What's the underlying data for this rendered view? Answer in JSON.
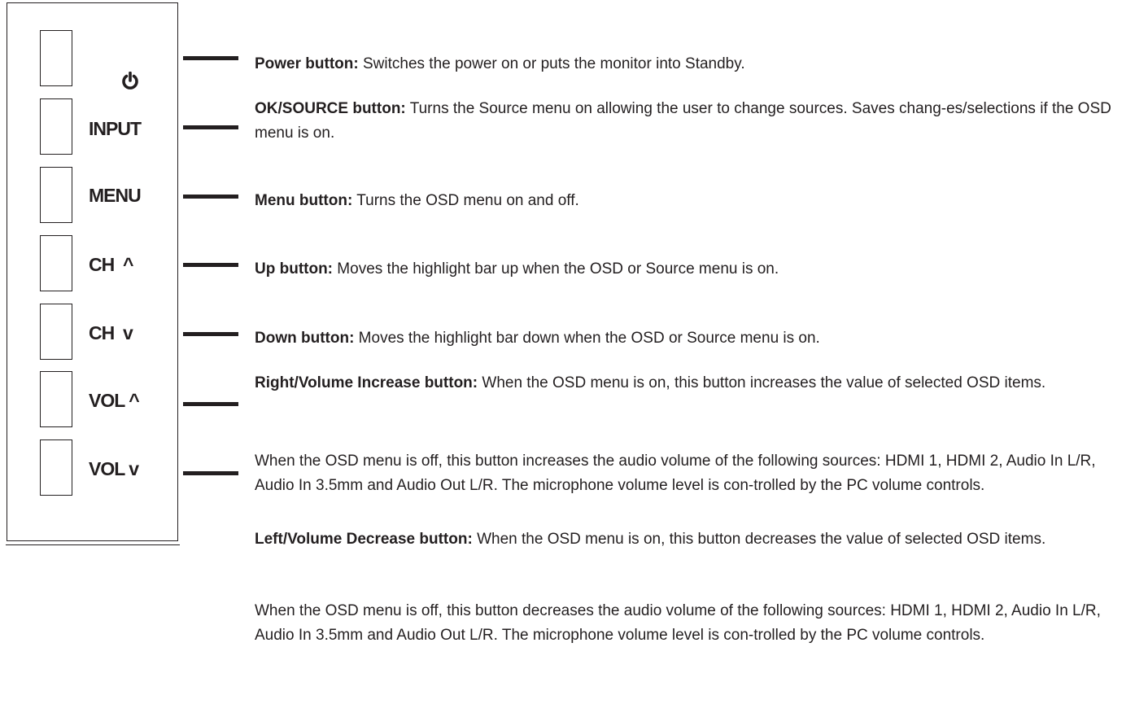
{
  "keys": [
    {
      "label": "",
      "icon": "power-icon"
    },
    {
      "label": "INPUT"
    },
    {
      "label": "MENU"
    },
    {
      "label": "CH  ^"
    },
    {
      "label": "CH  v"
    },
    {
      "label": "VOL ^"
    },
    {
      "label": "VOL v"
    }
  ],
  "descriptions": [
    {
      "title": "Power button:",
      "text": " Switches the power on or puts the monitor into Standby."
    },
    {
      "title": "OK/SOURCE button:",
      "text": " Turns the Source menu on allowing the user to change sources. Saves chang-es/selections if the OSD menu is on."
    },
    {
      "title": "Menu button:",
      "text": " Turns the OSD menu on and off."
    },
    {
      "title": "Up button:",
      "text": " Moves the highlight bar up when the OSD or Source menu is on."
    },
    {
      "title": "Down button:",
      "text": " Moves the highlight bar down when the OSD or Source menu is on."
    },
    {
      "title": "Right/Volume Increase button:",
      "text": " When the OSD menu is on, this button increases the value of selected OSD items."
    },
    {
      "title": "",
      "text": "When the OSD menu is off, this button increases the audio volume of the following sources:  HDMI 1, HDMI 2, Audio In L/R, Audio In 3.5mm and Audio Out L/R. The microphone volume level is con-trolled by the PC volume controls."
    },
    {
      "title": "Left/Volume Decrease button:",
      "text": " When the OSD menu is on, this button decreases the value of selected OSD items."
    },
    {
      "title": "",
      "text": "When the OSD menu is off, this button decreases the audio volume of the following sources:  HDMI 1, HDMI 2, Audio In L/R, Audio In 3.5mm and Audio Out L/R. The microphone volume level is con-trolled by the PC volume controls."
    }
  ]
}
